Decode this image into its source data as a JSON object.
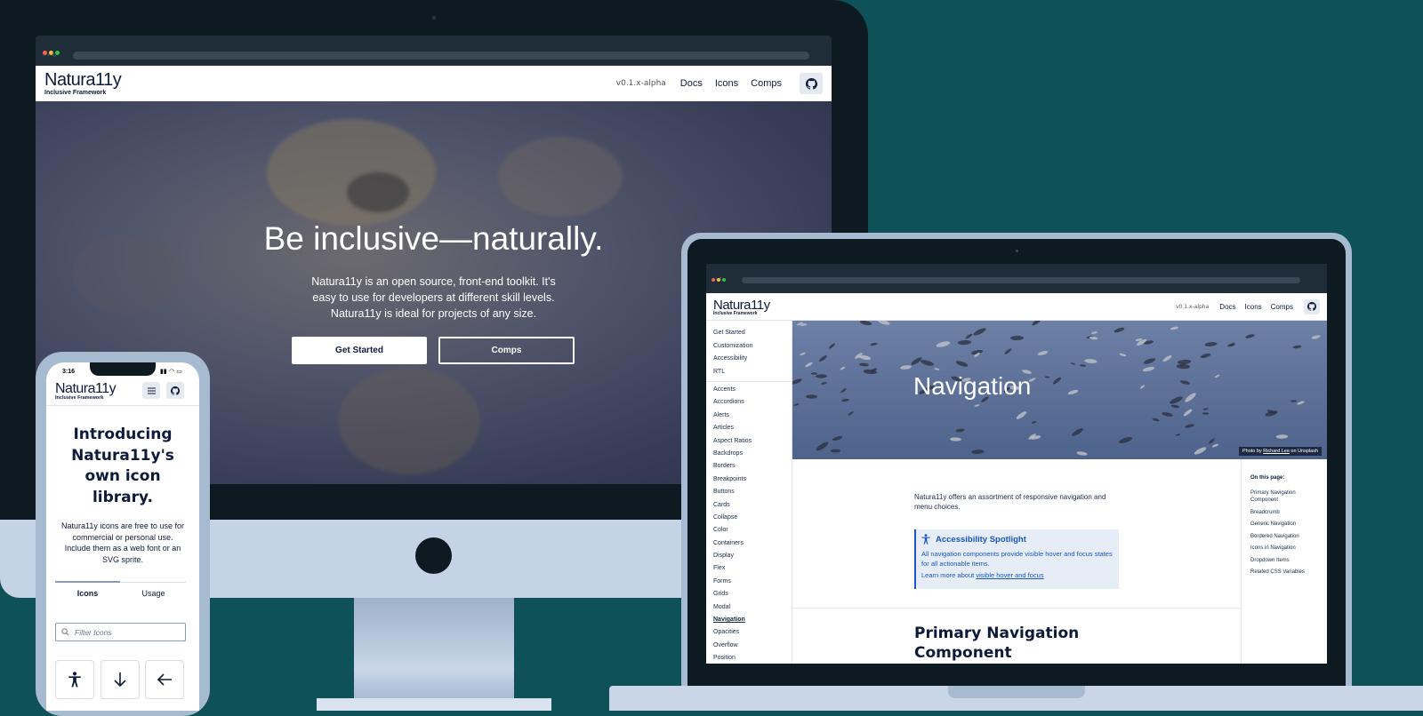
{
  "desktop": {
    "brand": {
      "name": "Natura11y",
      "tagline": "Inclusive Framework"
    },
    "nav": {
      "version": "v0.1.x-alpha",
      "docs": "Docs",
      "icons": "Icons",
      "comps": "Comps"
    },
    "hero": {
      "title": "Be inclusive—naturally.",
      "line1": "Natura11y is an open source, front-end toolkit. It's",
      "line2": "easy to use for developers at different skill levels.",
      "line3": "Natura11y is ideal for projects of any size.",
      "get_started": "Get Started",
      "comps": "Comps"
    }
  },
  "laptop": {
    "brand": {
      "name": "Natura11y",
      "tagline": "Inclusive Framework"
    },
    "nav": {
      "version": "v0.1.x-alpha",
      "docs": "Docs",
      "icons": "Icons",
      "comps": "Comps"
    },
    "sidebar_top": [
      "Get Started",
      "Customization",
      "Accessibility",
      "RTL"
    ],
    "sidebar_items": [
      "Accents",
      "Accordions",
      "Alerts",
      "Articles",
      "Aspect Ratios",
      "Backdrops",
      "Borders",
      "Breakpoints",
      "Buttons",
      "Cards",
      "Collapse",
      "Color",
      "Containers",
      "Display",
      "Flex",
      "Forms",
      "Grids",
      "Modal",
      "Navigation",
      "Opacities",
      "Overflow",
      "Position"
    ],
    "banner_title": "Navigation",
    "photo_credit": {
      "prefix": "Photo by",
      "author": "Richard Lee",
      "suffix": "on Unsplash"
    },
    "intro": "Natura11y offers an assortment of responsive navigation and menu choices.",
    "spotlight": {
      "title": "Accessibility Spotlight",
      "body": "All navigation components provide visible hover and focus states for all actionable items.",
      "learn": "Learn more about",
      "link": "visible hover and focus"
    },
    "section_heading_1": "Primary Navigation",
    "section_heading_2": "Component",
    "toc_title": "On this page:",
    "toc": [
      "Primary Navigation Component",
      "Breadcrumb",
      "Generic Navigation",
      "Bordered Navigation",
      "Icons in Navigation",
      "Dropdown Items",
      "Related CSS Variables"
    ]
  },
  "phone": {
    "time": "3:16",
    "brand": {
      "name": "Natura11y",
      "tagline": "Inclusive Framework"
    },
    "heading_1": "Introducing",
    "heading_2": "Natura11y's",
    "heading_3": "own icon",
    "heading_4": "library.",
    "body_1": "Natura11y icons are free to use for",
    "body_2": "commercial or personal use.",
    "body_3": "Include them as a web font or an",
    "body_4": "SVG sprite.",
    "tabs": {
      "icons": "Icons",
      "usage": "Usage"
    },
    "filter_placeholder": "Filter Icons",
    "icon_names": [
      "accessibility-icon",
      "arrow-down-icon",
      "arrow-left-icon"
    ]
  },
  "colors": {
    "background": "#0e5157",
    "brand_navy": "#0e1a3a",
    "spotlight_bg": "#e6edf7",
    "spotlight_accent": "#1a56c8",
    "device_frame": "#a6bad0"
  }
}
